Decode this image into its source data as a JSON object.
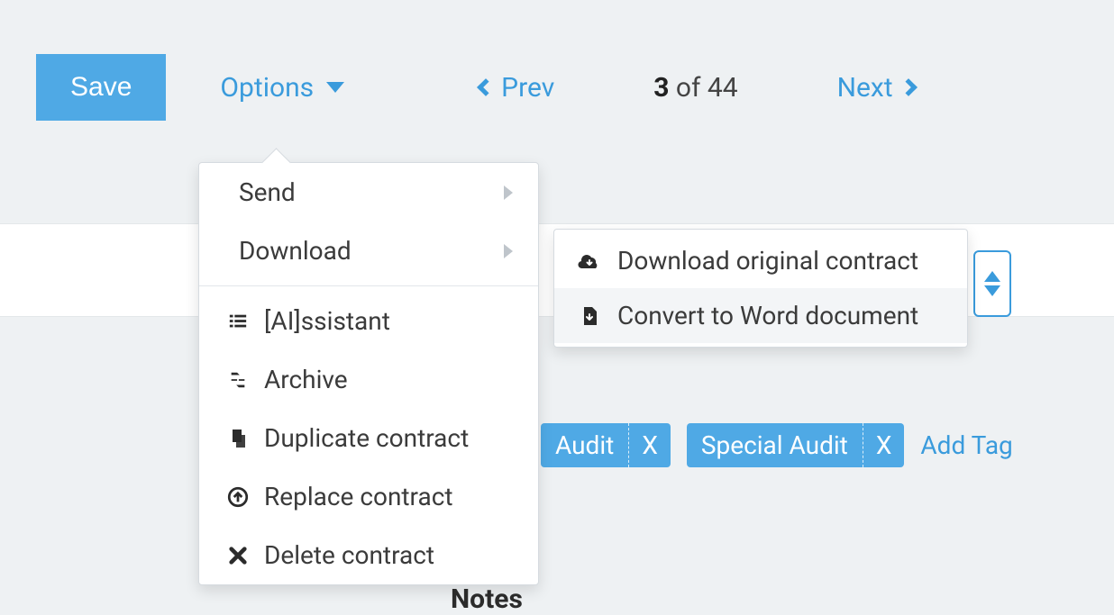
{
  "toolbar": {
    "save_label": "Save",
    "options_label": "Options"
  },
  "pager": {
    "prev_label": "Prev",
    "next_label": "Next",
    "current": "3",
    "sep": " of ",
    "total": "44"
  },
  "options_menu": {
    "send_label": "Send",
    "download_label": "Download",
    "assistant_label": "[AI]ssistant",
    "archive_label": "Archive",
    "duplicate_label": "Duplicate contract",
    "replace_label": "Replace contract",
    "delete_label": "Delete contract"
  },
  "download_submenu": {
    "original_label": "Download original contract",
    "convert_label": "Convert to Word document"
  },
  "tags": {
    "items": [
      {
        "label": "Audit",
        "x": "X"
      },
      {
        "label": "Special Audit",
        "x": "X"
      }
    ],
    "add_label": "Add Tag"
  },
  "notes_heading": "Notes"
}
